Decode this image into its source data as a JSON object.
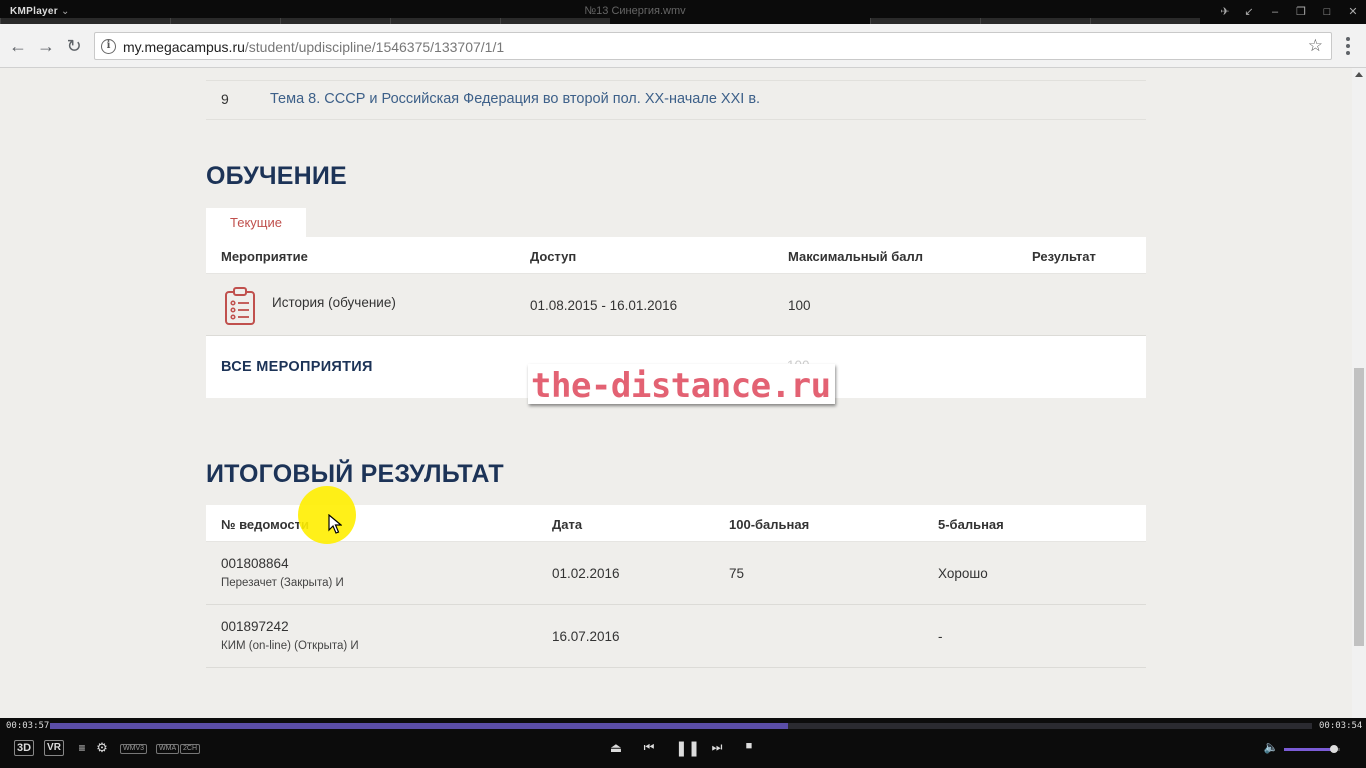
{
  "player": {
    "brand": "KMPlayer",
    "window_title": "№13 Синергия.wmv",
    "time_elapsed": "00:03:57",
    "time_total": "00:03:54",
    "progress": 0.585,
    "volume": 0.9,
    "badges": [
      "WMV3",
      "WMA",
      "2CH"
    ],
    "label_3d": "3D",
    "label_vr": "VR"
  },
  "browser": {
    "url_host": "my.megacampus.ru",
    "url_path": "/student/updiscipline/1546375/133707/1/1"
  },
  "topics": {
    "num": "9",
    "title": "Тема 8. СССР и Российская Федерация во второй пол. XX-начале XXI в."
  },
  "learning": {
    "heading": "ОБУЧЕНИЕ",
    "tab_current": "Текущие",
    "columns": [
      "Мероприятие",
      "Доступ",
      "Максимальный балл",
      "Результат"
    ],
    "rows": [
      {
        "name": "История (обучение)",
        "access": "01.08.2015 - 16.01.2016",
        "max": "100",
        "result": ""
      }
    ],
    "all_label": "ВСЕ МЕРОПРИЯТИЯ",
    "all_max": "100"
  },
  "watermark": "the-distance.ru",
  "final": {
    "heading": "ИТОГОВЫЙ РЕЗУЛЬТАТ",
    "columns": [
      "№ ведомости",
      "Дата",
      "100-бальная",
      "5-бальная"
    ],
    "rows": [
      {
        "id": "001808864",
        "desc": "Перезачет (Закрыта) И",
        "date": "01.02.2016",
        "score100": "75",
        "score5": "Хорошо"
      },
      {
        "id": "001897242",
        "desc": "КИМ (on-line) (Открыта) И",
        "date": "16.07.2016",
        "score100": "",
        "score5": "-"
      }
    ]
  },
  "colors": {
    "heading": "#1c3357",
    "link": "#3d6089",
    "accent_red": "#c0504d",
    "watermark": "#e36273",
    "seek_fill": "#5b4ea8"
  }
}
